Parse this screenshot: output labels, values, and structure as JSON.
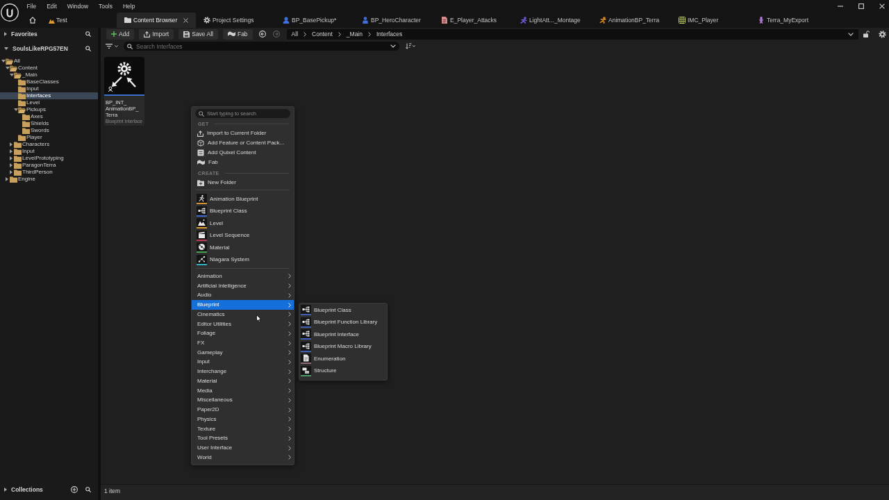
{
  "menu_bar": {
    "items": [
      "File",
      "Edit",
      "Window",
      "Tools",
      "Help"
    ]
  },
  "level_tab": {
    "label": "Test"
  },
  "tabs": [
    {
      "label": "Content Browser",
      "selected": true,
      "color": "#d4d4d4"
    },
    {
      "label": "Project Settings",
      "selected": false,
      "color": "#d4d4d4"
    },
    {
      "label": "BP_BasePickup*",
      "selected": false,
      "color": "#3f6fd8"
    },
    {
      "label": "BP_HeroCharacter",
      "selected": false,
      "color": "#3f6fd8"
    },
    {
      "label": "E_Player_Attacks",
      "selected": false,
      "color": "#d98c8c"
    },
    {
      "label": "LightAtt..._Montage",
      "selected": false,
      "color": "#6f5ad8"
    },
    {
      "label": "AnimationBP_Terra",
      "selected": false,
      "color": "#d98a22"
    },
    {
      "label": "IMC_Player",
      "selected": false,
      "color": "#c9d65a"
    },
    {
      "label": "Terra_MyExport",
      "selected": false,
      "color": "#b27ad6"
    }
  ],
  "sidebar": {
    "favorites": {
      "label": "Favorites",
      "expanded": false
    },
    "project": {
      "label": "SoulsLikeRPG57EN",
      "expanded": true
    },
    "tree": [
      {
        "label": "All",
        "kind": "branch",
        "expanded": true,
        "selected": false,
        "children": [
          {
            "label": "Content",
            "kind": "branch",
            "expanded": true,
            "selected": false,
            "children": [
              {
                "label": "_Main",
                "kind": "branch",
                "expanded": true,
                "selected": false,
                "children": [
                  {
                    "label": "BaseClasses",
                    "kind": "leaf",
                    "selected": false
                  },
                  {
                    "label": "Input",
                    "kind": "leaf",
                    "selected": false
                  },
                  {
                    "label": "Interfaces",
                    "kind": "leaf",
                    "selected": true
                  },
                  {
                    "label": "Level",
                    "kind": "leaf",
                    "selected": false
                  },
                  {
                    "label": "Pickups",
                    "kind": "branch",
                    "expanded": true,
                    "selected": false,
                    "children": [
                      {
                        "label": "Axes",
                        "kind": "leaf",
                        "selected": false
                      },
                      {
                        "label": "Shields",
                        "kind": "leaf",
                        "selected": false
                      },
                      {
                        "label": "Swords",
                        "kind": "leaf",
                        "selected": false
                      }
                    ]
                  },
                  {
                    "label": "Player",
                    "kind": "leaf",
                    "selected": false
                  }
                ]
              },
              {
                "label": "Characters",
                "kind": "branch",
                "expanded": false,
                "selected": false
              },
              {
                "label": "Input",
                "kind": "branch",
                "expanded": false,
                "selected": false
              },
              {
                "label": "LevelPrototyping",
                "kind": "branch",
                "expanded": false,
                "selected": false
              },
              {
                "label": "ParagonTerra",
                "kind": "branch",
                "expanded": false,
                "selected": false
              },
              {
                "label": "ThirdPerson",
                "kind": "branch",
                "expanded": false,
                "selected": false
              }
            ]
          },
          {
            "label": "Engine",
            "kind": "branch",
            "expanded": false,
            "selected": false
          }
        ]
      }
    ],
    "collections": {
      "label": "Collections",
      "expanded": false
    }
  },
  "toolbar": {
    "buttons": [
      {
        "label": "Add"
      },
      {
        "label": "Import"
      },
      {
        "label": "Save All"
      },
      {
        "label": "Fab"
      }
    ],
    "history": {
      "back": {
        "disabled": false
      },
      "forward": {
        "disabled": true
      }
    },
    "breadcrumbs": [
      "All",
      "Content",
      "_Main",
      "Interfaces"
    ]
  },
  "filter_bar": {
    "search": {
      "placeholder": "Search Interfaces"
    }
  },
  "assets": [
    {
      "name": "BP_INT_AnimationBP_Terra",
      "type": "Blueprint Interface"
    }
  ],
  "status_bar": {
    "text": "1 item"
  },
  "context_menu": {
    "search": {
      "placeholder": "Start typing to search"
    },
    "sections": [
      {
        "heading": "GET",
        "items": [
          "Import to Current Folder",
          "Add Feature or Content Pack...",
          "Add Quixel Content",
          "Fab"
        ]
      },
      {
        "heading": "CREATE",
        "items": [
          "New Folder"
        ]
      }
    ],
    "assets": [
      {
        "label": "Animation Blueprint",
        "color": "#d9922b"
      },
      {
        "label": "Blueprint Class",
        "color": "#3d66d1"
      },
      {
        "label": "Level",
        "color": "#e09a2a"
      },
      {
        "label": "Level Sequence",
        "color": "#c23a52"
      },
      {
        "label": "Material",
        "color": "#45a24f"
      },
      {
        "label": "Niagara System",
        "color": "#2fb3c4"
      }
    ],
    "categories": [
      {
        "label": "Animation",
        "selected": false
      },
      {
        "label": "Artificial Intelligence",
        "selected": false
      },
      {
        "label": "Audio",
        "selected": false
      },
      {
        "label": "Blueprint",
        "selected": true
      },
      {
        "label": "Cinematics",
        "selected": false
      },
      {
        "label": "Editor Utilities",
        "selected": false
      },
      {
        "label": "Foliage",
        "selected": false
      },
      {
        "label": "FX",
        "selected": false
      },
      {
        "label": "Gameplay",
        "selected": false
      },
      {
        "label": "Input",
        "selected": false
      },
      {
        "label": "Interchange",
        "selected": false
      },
      {
        "label": "Material",
        "selected": false
      },
      {
        "label": "Media",
        "selected": false
      },
      {
        "label": "Miscellaneous",
        "selected": false
      },
      {
        "label": "Paper2D",
        "selected": false
      },
      {
        "label": "Physics",
        "selected": false
      },
      {
        "label": "Texture",
        "selected": false
      },
      {
        "label": "Tool Presets",
        "selected": false
      },
      {
        "label": "User Interface",
        "selected": false
      },
      {
        "label": "World",
        "selected": false
      }
    ]
  },
  "submenu": {
    "items": [
      {
        "label": "Blueprint Class",
        "color": "#3d5fb8"
      },
      {
        "label": "Blueprint Function Library",
        "color": "#3d5fb8"
      },
      {
        "label": "Blueprint Interface",
        "color": "#3d5fb8"
      },
      {
        "label": "Blueprint Macro Library",
        "color": "#3d5fb8"
      },
      {
        "label": "Enumeration",
        "color": "#8f6a74"
      },
      {
        "label": "Structure",
        "color": "#4a9b6c"
      }
    ]
  }
}
